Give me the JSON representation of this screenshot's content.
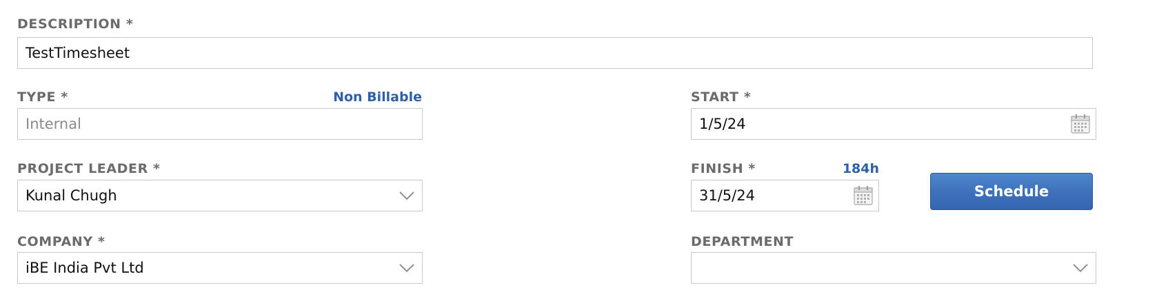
{
  "description": {
    "label": "DESCRIPTION *",
    "value": "TestTimesheet"
  },
  "type": {
    "label": "TYPE *",
    "placeholder": "Internal",
    "billing_link": "Non Billable"
  },
  "start": {
    "label": "START *",
    "value": "1/5/24",
    "icon": "calendar-icon"
  },
  "project_leader": {
    "label": "PROJECT LEADER *",
    "value": "Kunal Chugh",
    "icon": "chevron-down-icon"
  },
  "finish": {
    "label": "FINISH *",
    "value": "31/5/24",
    "duration": "184h",
    "icon": "calendar-icon"
  },
  "schedule_button": {
    "label": "Schedule"
  },
  "company": {
    "label": "COMPANY *",
    "value": "iBE India Pvt Ltd",
    "icon": "chevron-down-icon"
  },
  "department": {
    "label": "DEPARTMENT",
    "value": "",
    "icon": "chevron-down-icon"
  },
  "colors": {
    "label": "#6b6b6b",
    "link": "#2e5fa8",
    "button": "#3c70b9",
    "border": "#c9c9c9"
  }
}
